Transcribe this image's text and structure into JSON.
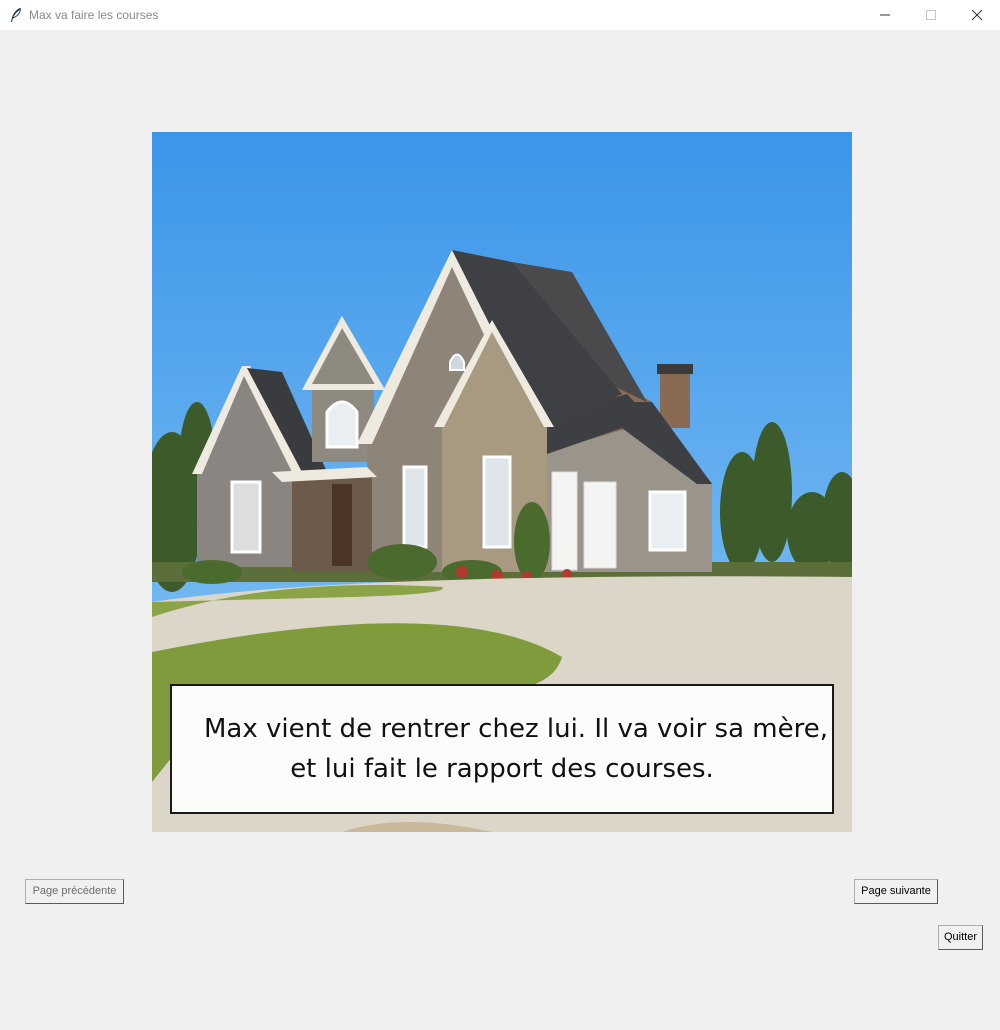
{
  "window": {
    "title": "Max va faire les courses",
    "app_icon": "feather-icon"
  },
  "story": {
    "image_description_icon": "house-illustration",
    "caption_line1": "Max vient de rentrer chez lui. Il va voir sa mère,",
    "caption_line2": "et lui fait le rapport des courses."
  },
  "navigation": {
    "prev_label": "Page précédente",
    "next_label": "Page suivante",
    "quit_label": "Quitter"
  },
  "colors": {
    "sky": "#4aa3f0",
    "lawn": "#7f9b3c",
    "drive": "#dcd6c8"
  }
}
